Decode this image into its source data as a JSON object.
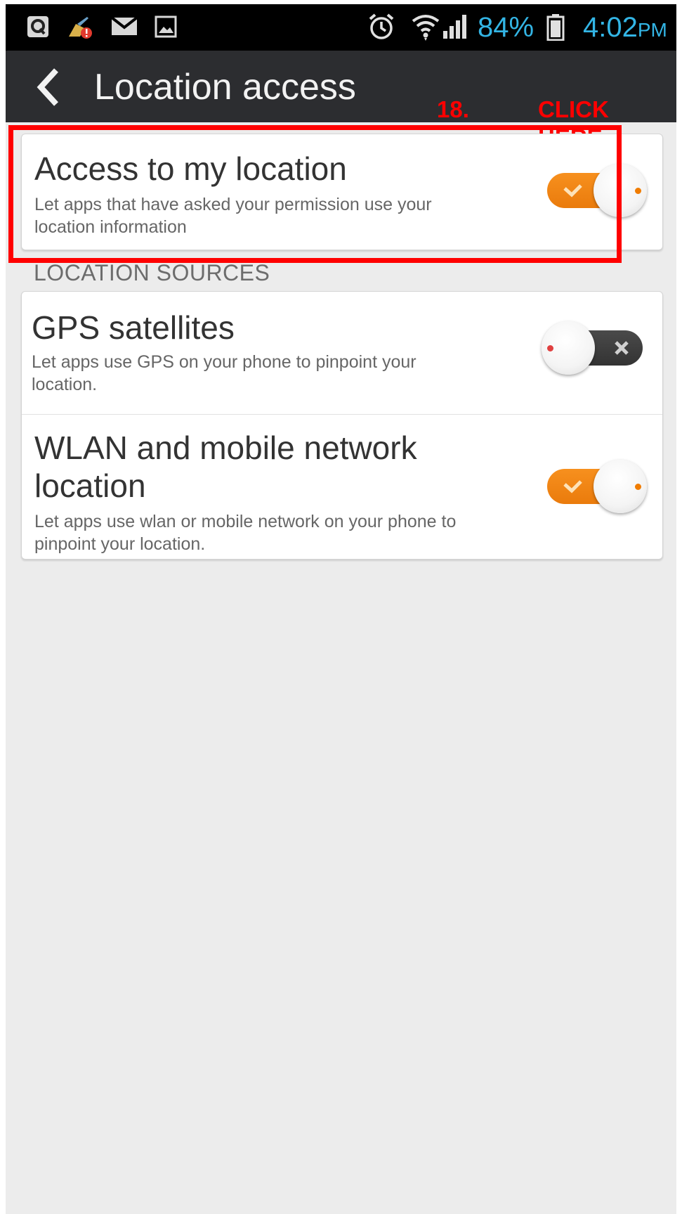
{
  "status_bar": {
    "battery_percent": "84%",
    "time": "4:02",
    "ampm": "PM",
    "icons": [
      "q-app-icon",
      "cleaner-alert-icon",
      "mail-icon",
      "image-icon",
      "alarm-icon",
      "wifi-icon",
      "signal-icon",
      "battery-icon"
    ],
    "accent": "#33b5e5"
  },
  "action_bar": {
    "title": "Location access"
  },
  "annotation": {
    "step": "18.",
    "instruction": "CLICK HERE",
    "color": "#ff0000"
  },
  "access_card": {
    "title": "Access to my location",
    "description_line1": "Let apps that have asked your permission use your",
    "description_line2": "location information",
    "enabled": true
  },
  "section_header": "LOCATION SOURCES",
  "sources": [
    {
      "title": "GPS satellites",
      "description_line1": "Let apps use GPS on your phone to pinpoint your",
      "description_line2": "location.",
      "enabled": false
    },
    {
      "title_line1": "WLAN and mobile network",
      "title_line2": "location",
      "description_line1": "Let apps use wlan or mobile network on your phone to",
      "description_line2": "pinpoint your location.",
      "enabled": true
    }
  ],
  "colors": {
    "toggle_on": "#f7901e",
    "toggle_off": "#3a3a3a",
    "background": "#ececec",
    "action_bar": "#2c2d30"
  }
}
